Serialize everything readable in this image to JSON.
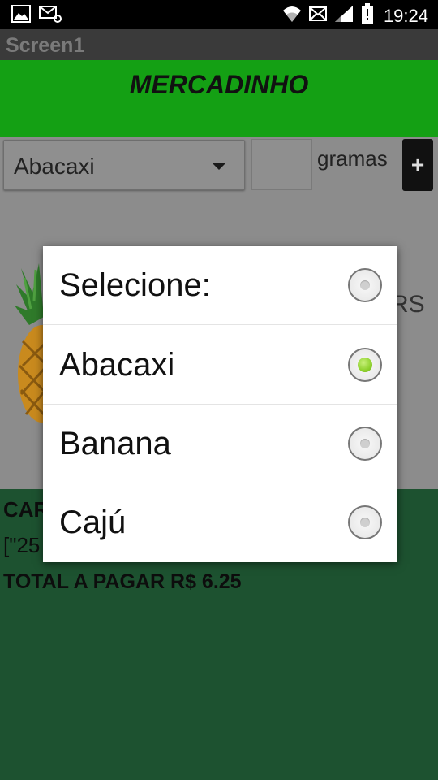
{
  "status_bar": {
    "time": "19:24",
    "left_icons": [
      "image-notification-icon",
      "email-notification-icon"
    ],
    "right_icons": [
      "wifi-icon",
      "message-icon",
      "signal-icon",
      "battery-alert-icon"
    ]
  },
  "app": {
    "title": "Screen1",
    "header": "MERCADINHO"
  },
  "form": {
    "product_selected": "Abacaxi",
    "quantity_value": "",
    "unit_label": "gramas",
    "add_button_label": "+",
    "price_partial": "RS"
  },
  "cart": {
    "label_partial": "CAR",
    "list_partial": "[\"25",
    "total": "TOTAL A PAGAR R$ 6.25"
  },
  "dialog": {
    "options": [
      {
        "label": "Selecione:",
        "selected": false
      },
      {
        "label": "Abacaxi",
        "selected": true
      },
      {
        "label": "Banana",
        "selected": false
      },
      {
        "label": "Cajú",
        "selected": false
      }
    ]
  },
  "colors": {
    "header_green": "#14a014",
    "bottom_green": "#1d5230",
    "radio_selected": "#8ed12d"
  }
}
